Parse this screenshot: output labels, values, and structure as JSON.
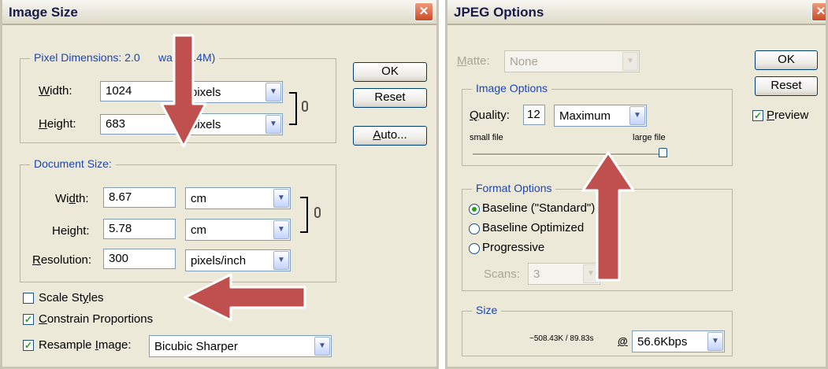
{
  "image_size": {
    "title": "Image Size",
    "pixel_dimensions": {
      "legend": "Pixel Dimensions:  2.0",
      "legend_tail": "was 36.4M)",
      "width_label": "Width:",
      "width_value": "1024",
      "width_unit": "pixels",
      "height_label": "Height:",
      "height_value": "683",
      "height_unit": "pixels"
    },
    "document_size": {
      "legend": "Document Size:",
      "width_label": "Width:",
      "width_value": "8.67",
      "width_unit": "cm",
      "height_label": "Height:",
      "height_value": "5.78",
      "height_unit": "cm",
      "resolution_label": "Resolution:",
      "resolution_value": "300",
      "resolution_unit": "pixels/inch"
    },
    "buttons": {
      "ok": "OK",
      "reset": "Reset",
      "auto": "Auto..."
    },
    "scale_styles": {
      "label": "Scale Styles",
      "checked": false
    },
    "constrain": {
      "label": "Constrain Proportions",
      "checked": true
    },
    "resample": {
      "label": "Resample Image:",
      "checked": true,
      "method": "Bicubic Sharper"
    }
  },
  "jpeg_options": {
    "title": "JPEG Options",
    "matte": {
      "label": "Matte:",
      "value": "None"
    },
    "image_options": {
      "legend": "Image Options",
      "quality_label": "Quality:",
      "quality_value": "12",
      "quality_preset": "Maximum",
      "small_file": "small file",
      "large_file": "large file",
      "quality_fraction": 1.0
    },
    "format_options": {
      "legend": "Format Options",
      "baseline_standard": "Baseline (\"Standard\")",
      "baseline_optimized": "Baseline Optimized",
      "progressive": "Progressive",
      "selected": "baseline_standard",
      "scans_label": "Scans:",
      "scans_value": "3"
    },
    "size": {
      "legend": "Size",
      "estimate": "~508.43K / 89.83s",
      "at": "@",
      "speed": "56.6Kbps"
    },
    "buttons": {
      "ok": "OK",
      "reset": "Reset"
    },
    "preview": {
      "label": "Preview",
      "checked": true
    }
  },
  "icons": {
    "close": "close-icon",
    "chain": "link-chain-icon",
    "annotation_arrow": "red-arrow-icon"
  },
  "colors": {
    "annotation_arrow": "#c0504d",
    "legend_text": "#1c44b4",
    "dialog_bg": "#ece9d8"
  }
}
